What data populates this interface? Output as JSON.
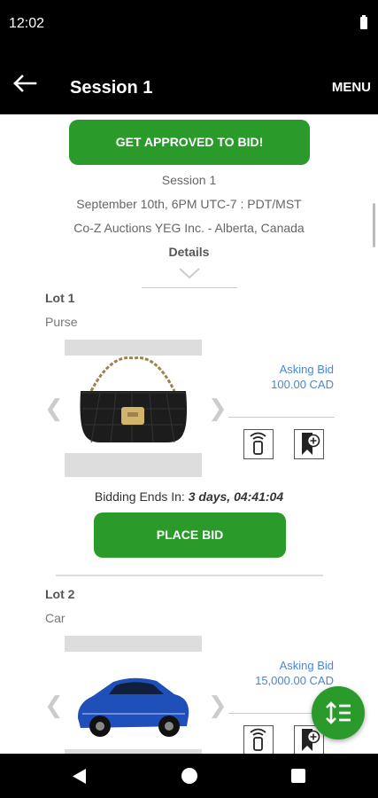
{
  "status": {
    "time": "12:02"
  },
  "appbar": {
    "title": "Session 1",
    "menu_label": "MENU"
  },
  "session": {
    "approve_label": "GET APPROVED TO BID!",
    "name": "Session 1",
    "date": "September 10th, 6PM UTC-7 : PDT/MST",
    "auctioneer": "Co-Z Auctions YEG Inc. - Alberta, Canada",
    "details_label": "Details"
  },
  "lots": [
    {
      "label": "Lot 1",
      "name": "Purse",
      "asking_label": "Asking Bid",
      "asking_value": "100.00 CAD",
      "ends_label": "Bidding Ends In:",
      "ends_value": "3 days, 04:41:04",
      "bid_label": "PLACE BID"
    },
    {
      "label": "Lot 2",
      "name": "Car",
      "asking_label": "Asking Bid",
      "asking_value": "15,000.00 CAD"
    }
  ],
  "colors": {
    "accent": "#2a9a2a",
    "link": "#4a86d8",
    "bar": "#000000"
  },
  "icons": {
    "back": "arrow-left-icon",
    "remote": "remote-bid-icon",
    "watchlist": "bookmark-add-icon",
    "fab": "sort-list-icon"
  }
}
